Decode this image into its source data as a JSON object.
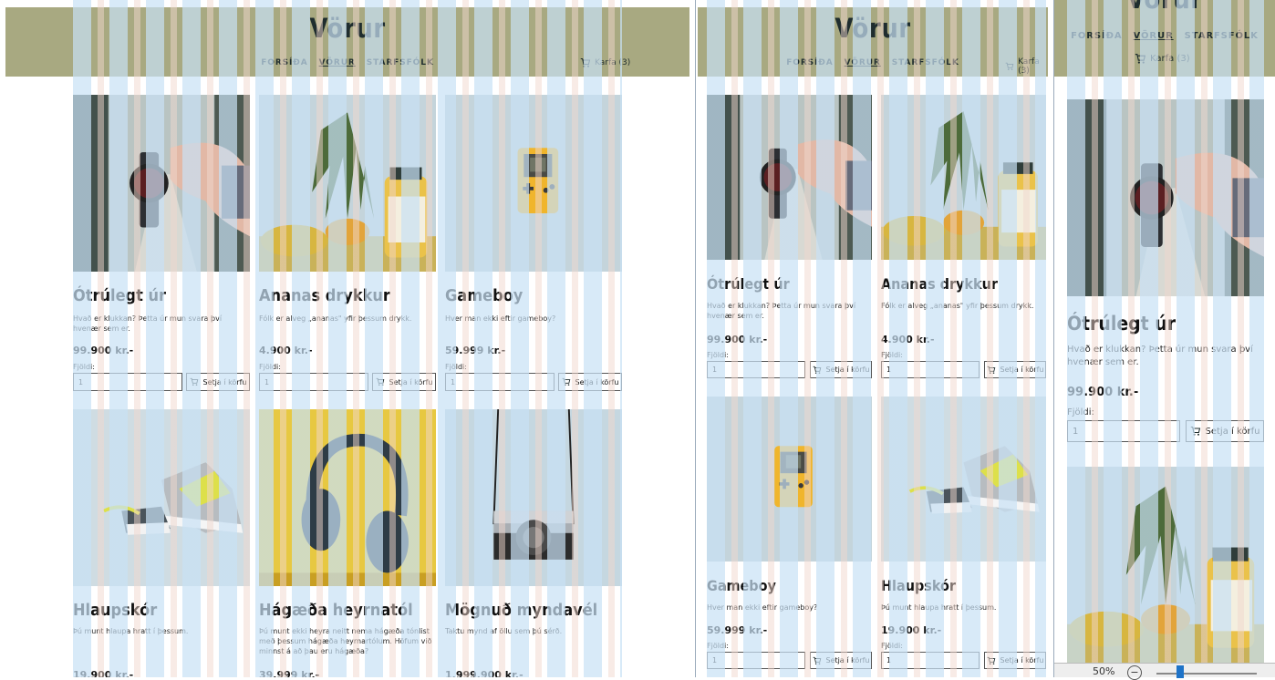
{
  "site": {
    "title": "Vörur"
  },
  "nav": {
    "items": [
      {
        "label": "FORSÍÐA"
      },
      {
        "label": "VÖRUR"
      },
      {
        "label": "STARFSFÓLK"
      }
    ]
  },
  "cart": {
    "label": "Karfa (3)"
  },
  "labels": {
    "qty": "Fjöldi:",
    "add": "Setja í körfu",
    "qty_value": "1"
  },
  "products": [
    {
      "name": "Ótrúlegt úr",
      "desc": "Hvað er klukkan? Þetta úr mun svara því hvenær sem er.",
      "price": "99.900 kr.-",
      "image": "watch"
    },
    {
      "name": "Ananas drykkur",
      "desc": "Fólk er alveg „ananas\" yfir þessum drykk.",
      "price": "4.900 kr.-",
      "image": "pineapple-juice"
    },
    {
      "name": "Gameboy",
      "desc": "Hver man ekki eftir gameboy?",
      "price": "59.999 kr.-",
      "image": "gameboy"
    },
    {
      "name": "Hlaupskór",
      "desc": "Þú munt hlaupa hratt í þessum.",
      "price": "19.900 kr.-",
      "image": "sneakers"
    },
    {
      "name": "Hágæða heyrnatól",
      "desc": "Þú munt ekki heyra neitt nema hágæða tónlist með þessum hágæða heyrnartólum. Höfum við minnst á að þau eru hágæða?",
      "price": "39.999 kr.-",
      "image": "headphones"
    },
    {
      "name": "Mögnuð myndavél",
      "desc": "Taktu mynd af öllu sem þú sérð.",
      "price": "1.999.900 kr.-",
      "image": "camera"
    }
  ],
  "zoom": {
    "value": "50%"
  },
  "colors": {
    "header": "#a8a981",
    "text": "#1f2d2e",
    "overlay_blue": "#c8e1f5"
  }
}
